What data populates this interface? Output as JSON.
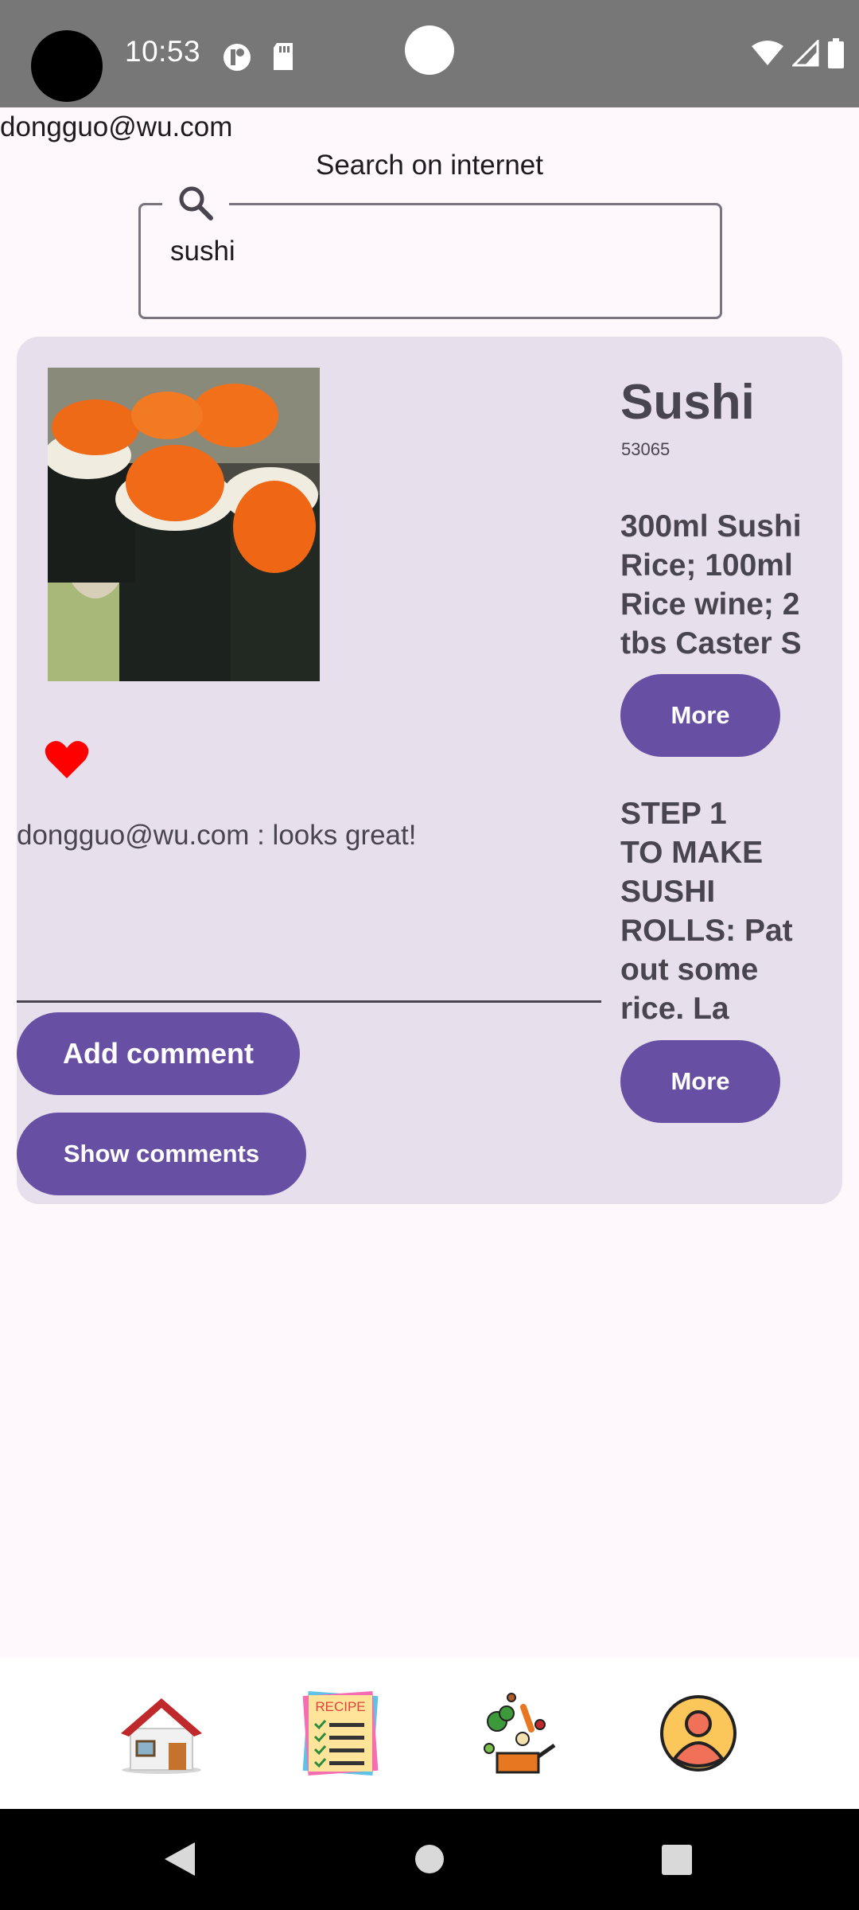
{
  "status_bar": {
    "time": "10:53",
    "icons_left": [
      "camera-cutout",
      "data-saver-icon",
      "sd-card-icon"
    ],
    "icons_right": [
      "wifi-icon",
      "signal-icon",
      "battery-icon"
    ]
  },
  "user": {
    "email": "dongguo@wu.com"
  },
  "search": {
    "label": "Search on internet",
    "value": "sushi",
    "icon": "search-icon"
  },
  "recipe": {
    "title": "Sushi",
    "id": "53065",
    "ingredients": "300ml  Sushi Rice; 100ml Rice wine; 2 tbs Caster S",
    "more_ingredients_label": "More",
    "steps": "STEP 1\nTO MAKE SUSHI ROLLS: Pat out some rice. La",
    "more_steps_label": "More",
    "favorited": true
  },
  "comments": {
    "items": [
      {
        "text": "dongguo@wu.com : looks great!"
      }
    ],
    "input_value": "",
    "add_label": "Add comment",
    "show_label": "Show comments"
  },
  "bottom_nav": {
    "items": [
      {
        "icon": "home-icon"
      },
      {
        "icon": "recipe-list-icon"
      },
      {
        "icon": "cooking-icon"
      },
      {
        "icon": "profile-icon"
      }
    ]
  },
  "colors": {
    "primary": "#6750a4",
    "card": "#e7e0ec",
    "background": "#fef7fb",
    "heart": "#ff0000",
    "status_bar": "#777777"
  }
}
